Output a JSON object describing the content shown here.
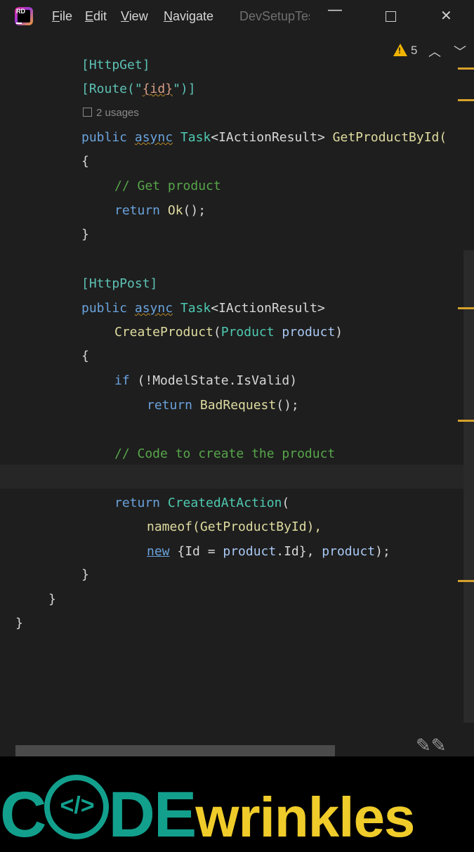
{
  "titlebar": {
    "logo_text": "RD",
    "menu": [
      "File",
      "Edit",
      "View",
      "Navigate"
    ],
    "menu_underline": [
      "F",
      "E",
      "V",
      "N"
    ],
    "window_title": "DevSetupTes"
  },
  "inspection": {
    "warning_count": "5"
  },
  "usages": "2 usages",
  "code": {
    "http_get": "[HttpGet]",
    "route_open": "[Route(\"",
    "route_param": "{id}",
    "route_close": "\")]",
    "public1": "public ",
    "async1": "async",
    "task1": "Task",
    "lt1": "<",
    "iaction1": "IActionResult",
    "gt1": "> ",
    "method1": "GetProductById(",
    "brace_open1": "{",
    "comment1": "// Get product",
    "return1": "return ",
    "ok": "Ok",
    "ok_end": "();",
    "brace_close1": "}",
    "http_post": "[HttpPost]",
    "public2": "public ",
    "async2": "async",
    "task2": "Task",
    "lt2": "<",
    "iaction2": "IActionResult",
    "gt2": ">",
    "method2": "CreateProduct",
    "paren2": "(",
    "ptype": "Product",
    "pname": " product",
    "paren2c": ")",
    "brace_open2": "{",
    "if_kw": "if",
    "if_rest": " (!ModelState.IsValid)",
    "return2": "return ",
    "badreq": "BadRequest",
    "badreq_end": "();",
    "comment2": "// Code to create the product",
    "return3": "return ",
    "created": "CreatedAtAction",
    "created_paren": "(",
    "nameof_line": "nameof(GetProductById),",
    "new_kw": "new",
    "anon_open": " {Id = ",
    "prod_ref": "product",
    "anon_prop": ".Id}, ",
    "prod_ref2": "product",
    "end_call": ");",
    "brace_close2": "}",
    "brace_close_class": "}",
    "brace_close_ns": "}"
  },
  "watermark": {
    "big": "C",
    "mid": "DE",
    "code_glyph": "</>",
    "small": "wrinkles"
  },
  "colors": {
    "accent_orange": "#d6a12b",
    "logo_teal": "#12a08d",
    "logo_yellow": "#f0cc2a"
  }
}
